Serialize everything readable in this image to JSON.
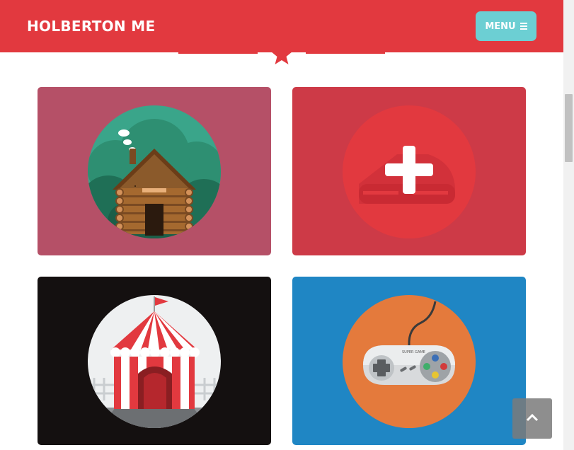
{
  "header": {
    "brand": "HOLBERTON ME",
    "menu_label": "MENU",
    "menu_icon": "hamburger-icon",
    "divider_icon": "star-icon",
    "background_color": "#e2393f",
    "menu_color": "#6ccfd3"
  },
  "portfolio": {
    "items": [
      {
        "icon": "log-cabin-icon",
        "background_color": "#b55067"
      },
      {
        "icon": "medical-plus-icon",
        "background_color": "#cd3a47"
      },
      {
        "icon": "circus-tent-icon",
        "background_color": "#141010"
      },
      {
        "icon": "game-controller-icon",
        "background_color": "#1f86c4",
        "controller_text": "SUPER GAME"
      }
    ]
  },
  "back_to_top": {
    "icon": "chevron-up-icon"
  }
}
